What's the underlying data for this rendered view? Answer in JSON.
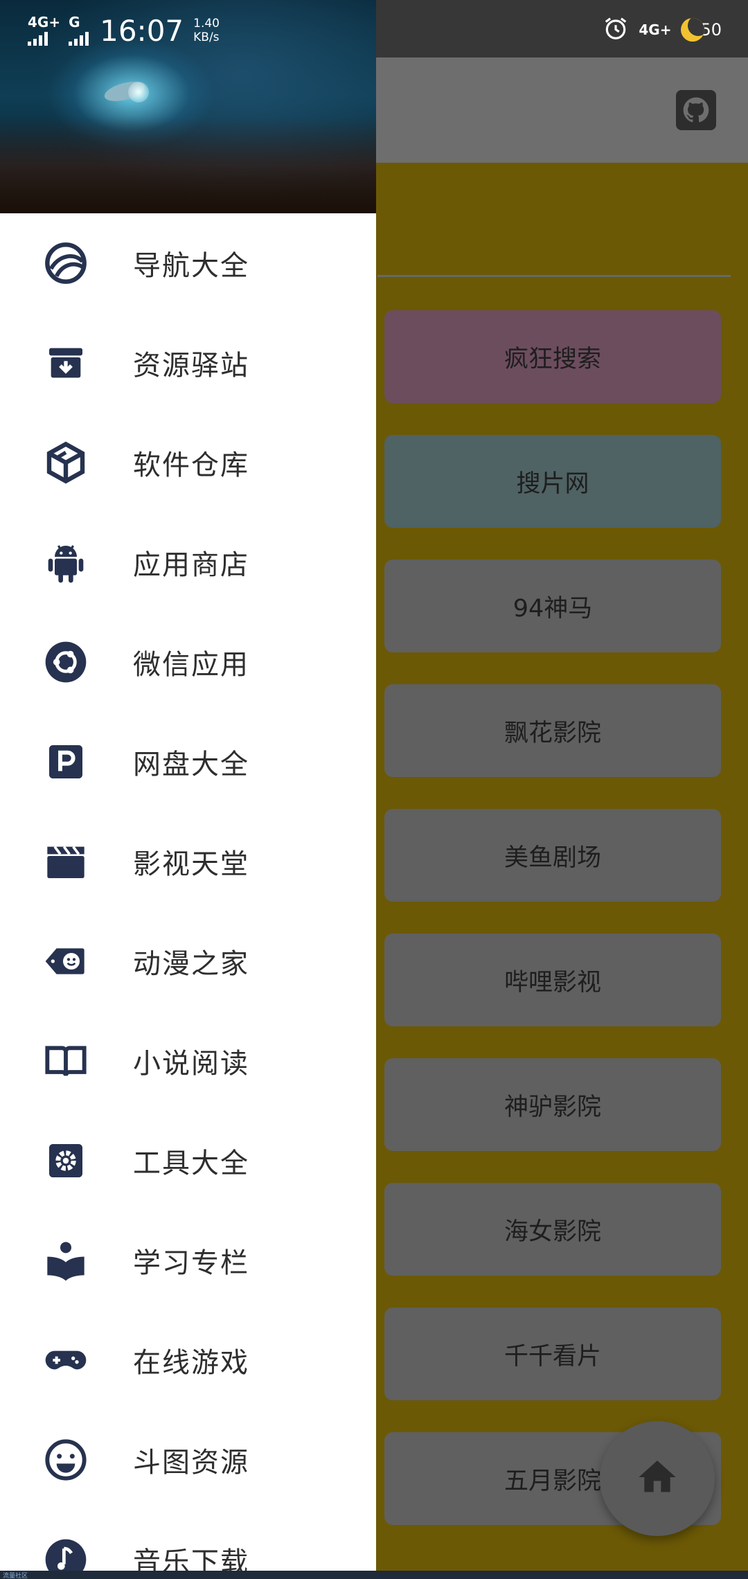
{
  "status_bar": {
    "left_signal_1": "4G+",
    "left_signal_2": "G",
    "time": "16:07",
    "speed_value": "1.40",
    "speed_unit": "KB/s",
    "right_network": "4G+",
    "battery": "50"
  },
  "toolbar": {
    "github_icon": "github-icon"
  },
  "sites": [
    {
      "label": "疯狂搜索",
      "color": "#6c4d5e"
    },
    {
      "label": "搜片网",
      "color": "#4f6264"
    },
    {
      "label": "94神马",
      "color": "#606060"
    },
    {
      "label": "飘花影院",
      "color": "#606060"
    },
    {
      "label": "美鱼剧场",
      "color": "#606060"
    },
    {
      "label": "哔哩影视",
      "color": "#606060"
    },
    {
      "label": "神驴影院",
      "color": "#606060"
    },
    {
      "label": "海女影院",
      "color": "#606060"
    },
    {
      "label": "千千看片",
      "color": "#606060"
    },
    {
      "label": "五月影院",
      "color": "#606060"
    }
  ],
  "drawer": {
    "items": [
      {
        "label": "导航大全",
        "icon": "globe-icon"
      },
      {
        "label": "资源驿站",
        "icon": "archive-icon"
      },
      {
        "label": "软件仓库",
        "icon": "box-icon"
      },
      {
        "label": "应用商店",
        "icon": "android-icon"
      },
      {
        "label": "微信应用",
        "icon": "ubuntu-icon"
      },
      {
        "label": "网盘大全",
        "icon": "parking-icon"
      },
      {
        "label": "影视天堂",
        "icon": "clapperboard-icon"
      },
      {
        "label": "动漫之家",
        "icon": "smile-tag-icon"
      },
      {
        "label": "小说阅读",
        "icon": "book-icon"
      },
      {
        "label": "工具大全",
        "icon": "gear-icon"
      },
      {
        "label": "学习专栏",
        "icon": "reader-icon"
      },
      {
        "label": "在线游戏",
        "icon": "gamepad-icon"
      },
      {
        "label": "斗图资源",
        "icon": "smile-icon"
      },
      {
        "label": "音乐下载",
        "icon": "music-icon"
      }
    ]
  },
  "fab": {
    "icon": "home-icon"
  },
  "nav_tip": "流量社区",
  "colors": {
    "icon": "#26324f",
    "app_bg": "#6b5906",
    "drawer_bg": "#ffffff"
  }
}
